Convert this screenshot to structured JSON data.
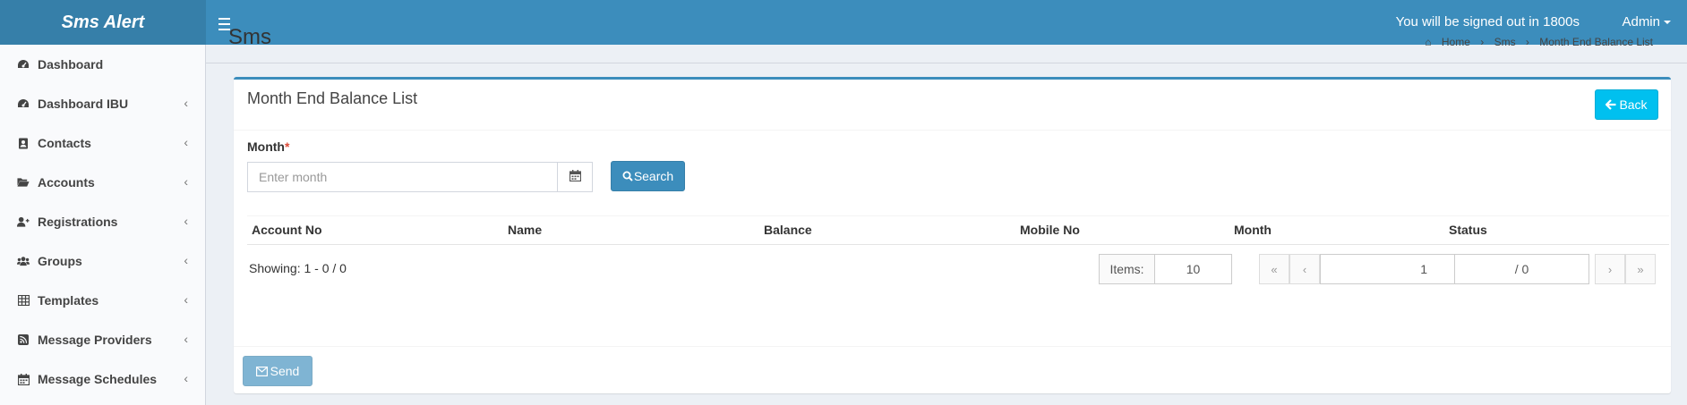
{
  "app": {
    "title": "Sms Alert"
  },
  "header": {
    "signout_text": "You will be signed out in 1800s",
    "user": "Admin"
  },
  "sidebar": {
    "items": [
      {
        "label": "Dashboard",
        "icon": "dashboard-icon",
        "has_children": false
      },
      {
        "label": "Dashboard IBU",
        "icon": "dashboard-icon",
        "has_children": true
      },
      {
        "label": "Contacts",
        "icon": "contacts-icon",
        "has_children": true
      },
      {
        "label": "Accounts",
        "icon": "folder-open-icon",
        "has_children": true
      },
      {
        "label": "Registrations",
        "icon": "user-plus-icon",
        "has_children": true
      },
      {
        "label": "Groups",
        "icon": "users-icon",
        "has_children": true
      },
      {
        "label": "Templates",
        "icon": "table-icon",
        "has_children": true
      },
      {
        "label": "Message Providers",
        "icon": "rss-icon",
        "has_children": true
      },
      {
        "label": "Message Schedules",
        "icon": "calendar-icon",
        "has_children": true
      }
    ]
  },
  "page": {
    "title": "Sms",
    "breadcrumb": [
      "Home",
      "Sms",
      "Month End Balance List"
    ]
  },
  "box": {
    "title": "Month End Balance List",
    "back_label": "Back",
    "month_label": "Month",
    "required_mark": "*",
    "month_placeholder": "Enter month",
    "month_value": "",
    "search_label": "Search",
    "send_label": "Send"
  },
  "table": {
    "columns": [
      "Account No",
      "Name",
      "Balance",
      "Mobile No",
      "Month",
      "Status"
    ],
    "rows": []
  },
  "pagination": {
    "showing": "Showing: 1 - 0 / 0",
    "items_label": "Items:",
    "items_value": "10",
    "first": "«",
    "prev": "‹",
    "page_value": "1",
    "page_total": "/ 0",
    "next": "›",
    "last": "»"
  },
  "colors": {
    "primary": "#3c8dbc",
    "info": "#00c0ef",
    "header_logo": "#367fa9"
  }
}
